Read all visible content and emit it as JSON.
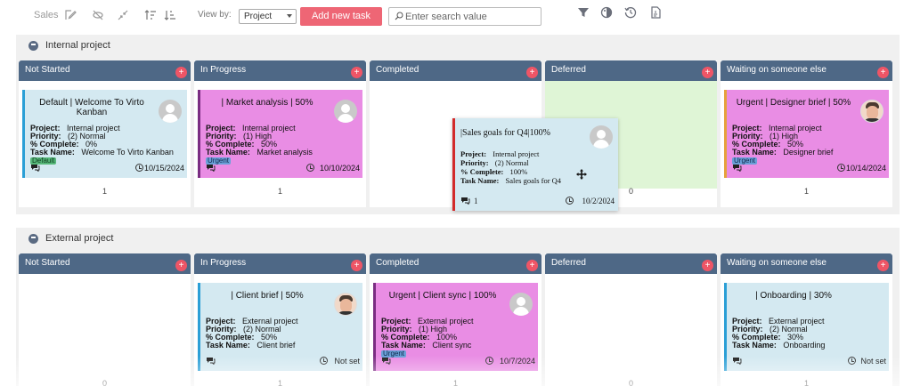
{
  "toolbar": {
    "title": "Sales",
    "view_by_label": "View by:",
    "view_by_value": "Project",
    "add_task_label": "Add new task",
    "search_placeholder": "Enter search value"
  },
  "icons": {
    "toolbar_left": [
      "edit-icon",
      "collapse-icon",
      "shrink-icon",
      "sort-asc-icon",
      "sort-desc-icon"
    ],
    "toolbar_right": [
      "filter-icon",
      "palette-icon",
      "history-icon",
      "pdf-icon"
    ]
  },
  "colors": {
    "header": "#4e6886",
    "add_button": "#ee6675",
    "card_blue": "#d4e9f1",
    "card_pink": "#e98de4",
    "deferred_green": "#dff5d6"
  },
  "field_labels": {
    "project": "Project:",
    "priority": "Priority:",
    "complete": "% Complete:",
    "task_name": "Task Name:"
  },
  "lanes": [
    {
      "title": "Internal project",
      "columns": [
        {
          "title": "Not Started",
          "count": "1"
        },
        {
          "title": "In Progress",
          "count": "1"
        },
        {
          "title": "Completed",
          "count": ""
        },
        {
          "title": "Deferred",
          "count": "0"
        },
        {
          "title": "Waiting on someone else",
          "count": "1"
        }
      ],
      "cards": [
        {
          "title": "Default | Welcome To Virto Kanban",
          "project": "Internal project",
          "priority": "(2) Normal",
          "complete": "0%",
          "task_name": "Welcome To Virto Kanban",
          "tag": "Default",
          "comments": "",
          "due": "10/15/2024"
        },
        {
          "title": "| Market analysis | 50%",
          "project": "Internal project",
          "priority": "(1) High",
          "complete": "50%",
          "task_name": "Market analysis",
          "tag": "Urgent",
          "comments": "",
          "due": "10/10/2024"
        },
        {
          "title": "Urgent | Designer brief | 50%",
          "project": "Internal project",
          "priority": "(1) High",
          "complete": "50%",
          "task_name": "Designer brief",
          "tag": "Urgent",
          "comments": "",
          "due": "10/14/2024"
        }
      ]
    },
    {
      "title": "External project",
      "columns": [
        {
          "title": "Not Started",
          "count": "0"
        },
        {
          "title": "In Progress",
          "count": "1"
        },
        {
          "title": "Completed",
          "count": "1"
        },
        {
          "title": "Deferred",
          "count": "0"
        },
        {
          "title": "Waiting on someone else",
          "count": "1"
        }
      ],
      "cards": [
        {
          "title": "| Client brief | 50%",
          "project": "External project",
          "priority": "(2) Normal",
          "complete": "50%",
          "task_name": "Client brief",
          "comments": "",
          "due": "Not set"
        },
        {
          "title": "Urgent | Client sync | 100%",
          "project": "External project",
          "priority": "(1) High",
          "complete": "100%",
          "task_name": "Client sync",
          "tag": "Urgent",
          "comments": "",
          "due": "10/7/2024"
        },
        {
          "title": "| Onboarding | 30%",
          "project": "External project",
          "priority": "(2) Normal",
          "complete": "30%",
          "task_name": "Onboarding",
          "comments": "",
          "due": "Not set"
        }
      ]
    }
  ],
  "dragging_card": {
    "title": "|Sales goals for Q4|100%",
    "project": "Internal project",
    "priority": "(2) Normal",
    "complete": "100%",
    "task_name": "Sales goals for Q4",
    "comments": "1",
    "due": "10/2/2024"
  }
}
